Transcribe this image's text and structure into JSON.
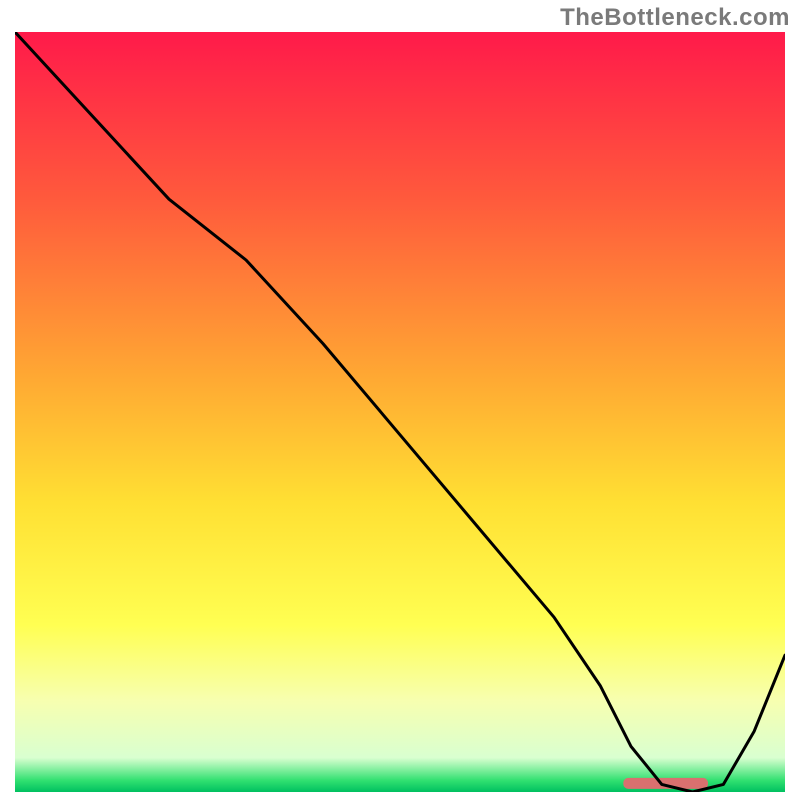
{
  "watermark": "TheBottleneck.com",
  "chart_data": {
    "type": "line",
    "title": "",
    "xlabel": "",
    "ylabel": "",
    "xlim": [
      0,
      100
    ],
    "ylim": [
      0,
      100
    ],
    "grid": false,
    "legend": false,
    "background_gradient_stops": [
      {
        "offset": 0.0,
        "color": "#ff1a4a"
      },
      {
        "offset": 0.22,
        "color": "#ff5a3c"
      },
      {
        "offset": 0.45,
        "color": "#ffa733"
      },
      {
        "offset": 0.62,
        "color": "#ffe033"
      },
      {
        "offset": 0.78,
        "color": "#ffff52"
      },
      {
        "offset": 0.88,
        "color": "#f7ffb0"
      },
      {
        "offset": 0.955,
        "color": "#d9ffd0"
      },
      {
        "offset": 0.985,
        "color": "#30e070"
      },
      {
        "offset": 1.0,
        "color": "#00c060"
      }
    ],
    "series": [
      {
        "name": "bottleneck-curve",
        "stroke": "#000000",
        "x": [
          0,
          10,
          20,
          30,
          40,
          50,
          60,
          70,
          76,
          80,
          84,
          88,
          92,
          96,
          100
        ],
        "y": [
          100,
          89,
          78,
          70,
          59,
          47,
          35,
          23,
          14,
          6,
          1,
          0,
          1,
          8,
          18
        ]
      }
    ],
    "marker": {
      "name": "sweet-spot-marker",
      "x_start": 79,
      "x_end": 90,
      "y": 1.2,
      "color": "#d9706f"
    }
  }
}
